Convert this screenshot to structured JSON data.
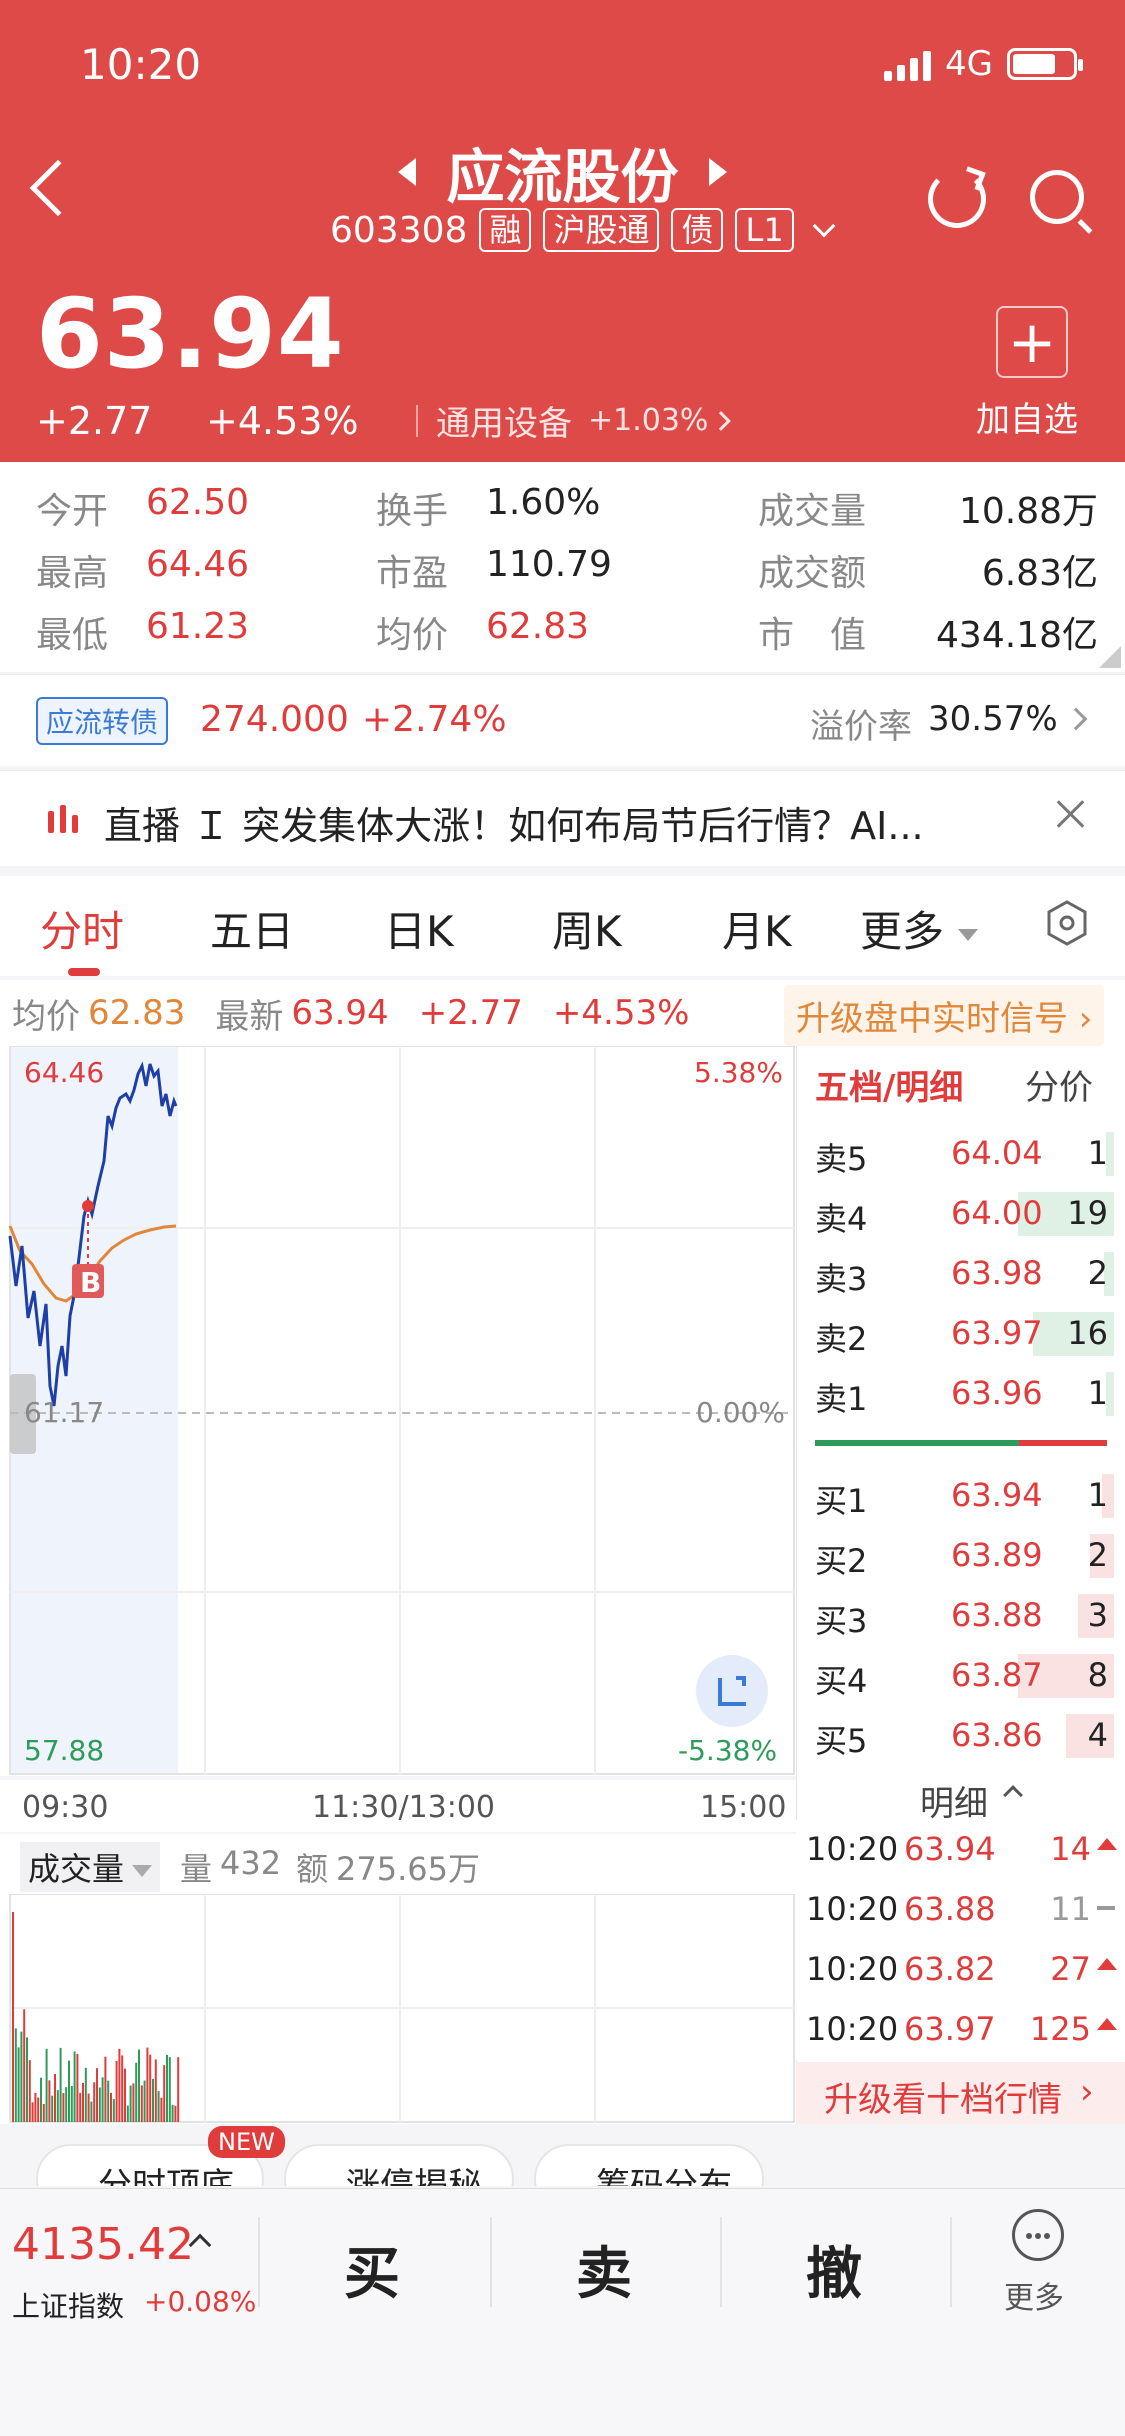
{
  "status_bar": {
    "time": "10:20",
    "network": "4G"
  },
  "header": {
    "stock_name": "应流股份",
    "code": "603308",
    "tags": [
      "融",
      "沪股通",
      "债",
      "L1"
    ],
    "price": "63.94",
    "change": "+2.77",
    "change_pct": "+4.53%",
    "sector": "通用设备",
    "sector_pct": "+1.03%",
    "add_watch_label": "加自选",
    "add_symbol": "+"
  },
  "stats": {
    "open": {
      "label": "今开",
      "value": "62.50"
    },
    "high": {
      "label": "最高",
      "value": "64.46"
    },
    "low": {
      "label": "最低",
      "value": "61.23"
    },
    "turnover": {
      "label": "换手",
      "value": "1.60%"
    },
    "pe": {
      "label": "市盈",
      "value": "110.79"
    },
    "avg": {
      "label": "均价",
      "value": "62.83"
    },
    "volume": {
      "label": "成交量",
      "value": "10.88万"
    },
    "amount": {
      "label": "成交额",
      "value": "6.83亿"
    },
    "mcap": {
      "label": "市　值",
      "value": "434.18亿"
    }
  },
  "bond": {
    "tag": "应流转债",
    "price": "274.000",
    "change_pct": "+2.74%",
    "premium_label": "溢价率",
    "premium_value": "30.57%"
  },
  "live": {
    "text": "直播 Ｉ 突发集体大涨！如何布局节后行情？AI..."
  },
  "tabs": [
    "分时",
    "五日",
    "日K",
    "周K",
    "月K",
    "更多"
  ],
  "info_row": {
    "avg_label": "均价",
    "avg_value": "62.83",
    "latest_label": "最新",
    "latest_value": "63.94",
    "change": "+2.77",
    "change_pct": "+4.53%",
    "upgrade": "升级盘中实时信号"
  },
  "chart": {
    "high_label": "64.46",
    "low_label": "57.88",
    "mid_label": "61.17",
    "pct_high": "5.38%",
    "pct_zero": "0.00%",
    "pct_low": "-5.38%",
    "marker": "B",
    "times": [
      "09:30",
      "11:30/13:00",
      "15:00"
    ]
  },
  "volume": {
    "label": "成交量",
    "qty_label": "量",
    "qty_value": "432",
    "amt_label": "额",
    "amt_value": "275.65万"
  },
  "order_book": {
    "header": "五档/明细",
    "header2": "分价",
    "asks": [
      {
        "label": "卖5",
        "price": "64.04",
        "qty": "1"
      },
      {
        "label": "卖4",
        "price": "64.00",
        "qty": "19"
      },
      {
        "label": "卖3",
        "price": "63.98",
        "qty": "2"
      },
      {
        "label": "卖2",
        "price": "63.97",
        "qty": "16"
      },
      {
        "label": "卖1",
        "price": "63.96",
        "qty": "1"
      }
    ],
    "bids": [
      {
        "label": "买1",
        "price": "63.94",
        "qty": "1"
      },
      {
        "label": "买2",
        "price": "63.89",
        "qty": "2"
      },
      {
        "label": "买3",
        "price": "63.88",
        "qty": "3"
      },
      {
        "label": "买4",
        "price": "63.87",
        "qty": "8"
      },
      {
        "label": "买5",
        "price": "63.86",
        "qty": "4"
      }
    ],
    "detail_label": "明细",
    "trades": [
      {
        "time": "10:20",
        "price": "63.94",
        "qty": "14"
      },
      {
        "time": "10:20",
        "price": "63.88",
        "qty": "11"
      },
      {
        "time": "10:20",
        "price": "63.82",
        "qty": "27"
      },
      {
        "time": "10:20",
        "price": "63.97",
        "qty": "125"
      }
    ],
    "upgrade": "升级看十档行情"
  },
  "chips": [
    "分时顶底",
    "涨停揭秘",
    "筹码分布"
  ],
  "chip_badge": "NEW",
  "bottom": {
    "index_value": "4135.42",
    "index_name": "上证指数",
    "index_change": "+0.08%",
    "buy": "买",
    "sell": "卖",
    "cancel": "撤",
    "more": "更多"
  },
  "colors": {
    "header_bg": "#dd4a48",
    "up": "#e03c3c",
    "down": "#2e9b5b",
    "price_line": "#1f3fa8",
    "avg_line": "#e0873a"
  }
}
